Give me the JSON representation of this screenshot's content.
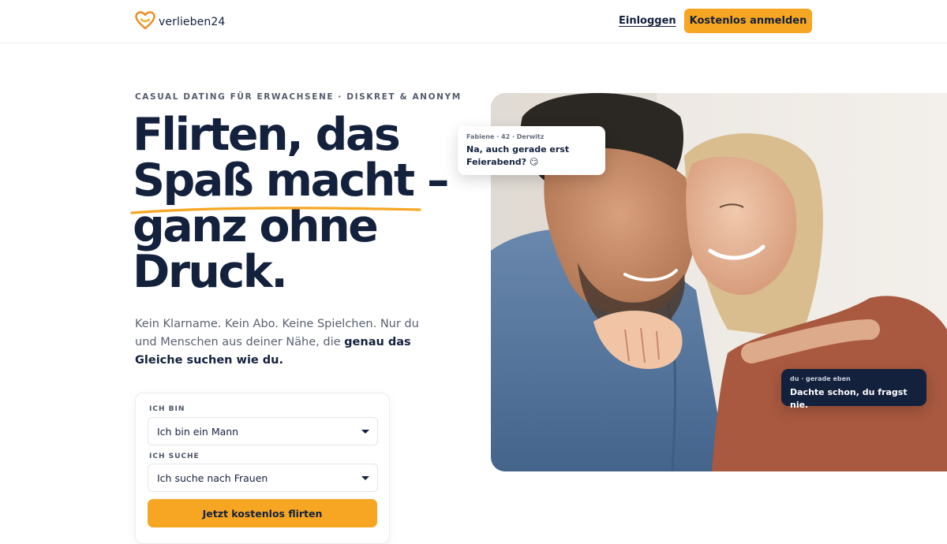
{
  "header": {
    "logo_text": "verlieben24",
    "login_label": "Einloggen",
    "signup_label": "Kostenlos anmelden"
  },
  "hero": {
    "eyebrow": "CASUAL DATING FÜR ERWACHSENE · DISKRET & ANONYM",
    "title_lines": [
      "Flirten, das",
      "Spaß macht –",
      "ganz ohne",
      "Druck."
    ],
    "lead_text": "Kein Klarname. Kein Abo. Keine Spielchen. Nur du und Menschen aus deiner Nähe, die ",
    "lead_highlight": "genau das Gleiche suchen wie du."
  },
  "form": {
    "iam_label": "ICH BIN",
    "iam_value": "Ich bin ein Mann",
    "seek_label": "ICH SUCHE",
    "seek_value": "Ich suche nach Frauen",
    "cta_label": "Jetzt kostenlos flirten"
  },
  "chat": {
    "incoming_meta": "Fabiene · 42 · Derwitz",
    "incoming_text": "Na, auch gerade erst Feierabend? 😏",
    "outgoing_meta": "du · gerade eben",
    "outgoing_text": "Dachte schon, du fragst nie."
  },
  "colors": {
    "accent": "#f6a623",
    "navy": "#14213d",
    "muted": "#5a6170"
  },
  "icons": {
    "logo": "heart-logo-icon",
    "select_caret": "caret-down-icon"
  }
}
